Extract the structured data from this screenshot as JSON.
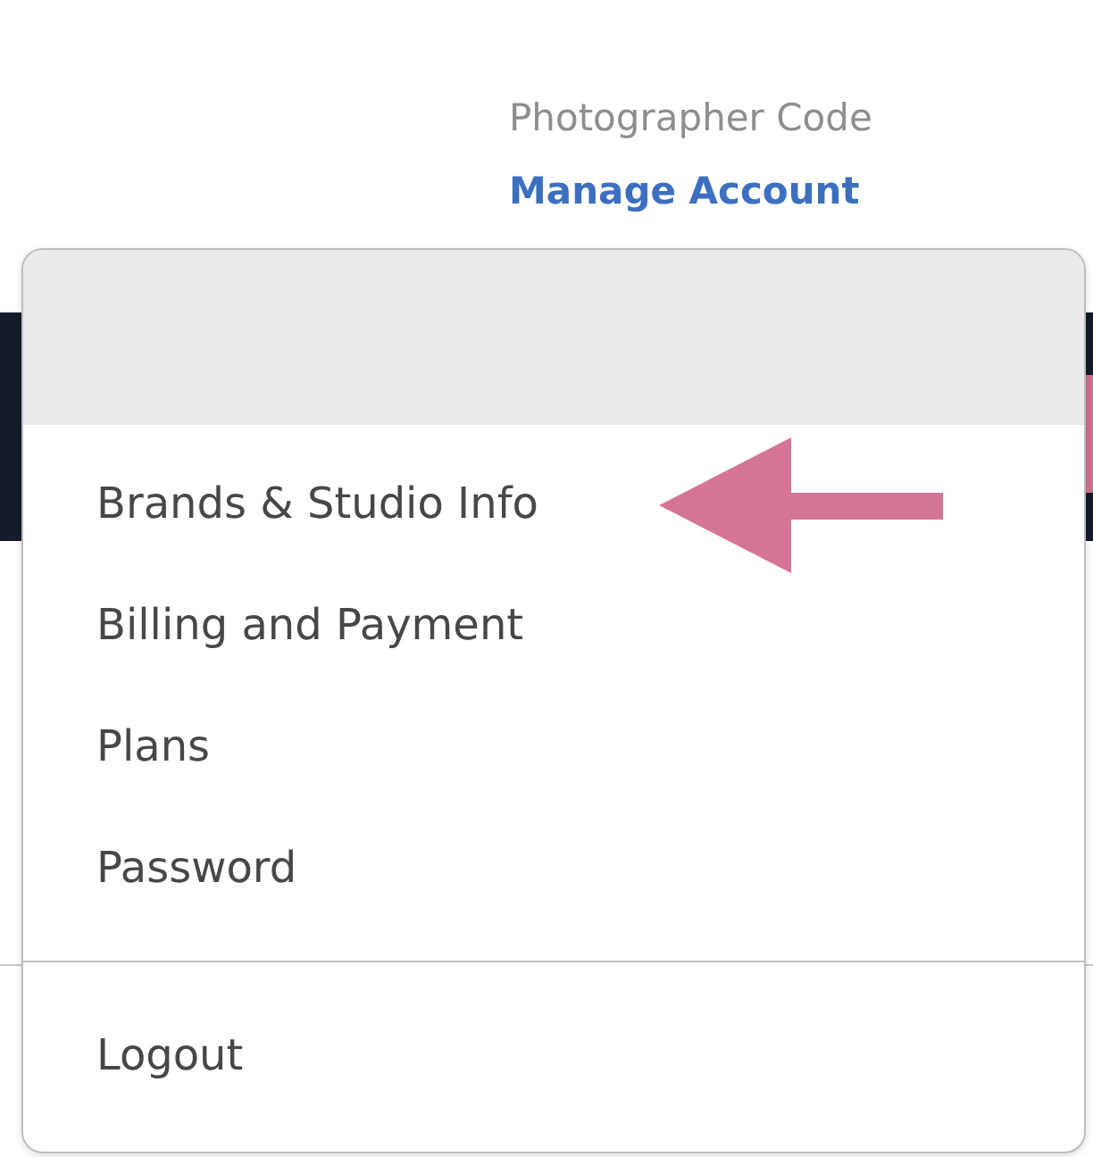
{
  "header": {
    "code_label": "Photographer Code",
    "account_link": "Manage Account"
  },
  "menu": {
    "items": [
      {
        "label": "Brands & Studio Info"
      },
      {
        "label": "Billing and Payment"
      },
      {
        "label": "Plans"
      },
      {
        "label": "Password"
      }
    ],
    "footer_items": [
      {
        "label": "Logout"
      }
    ]
  }
}
